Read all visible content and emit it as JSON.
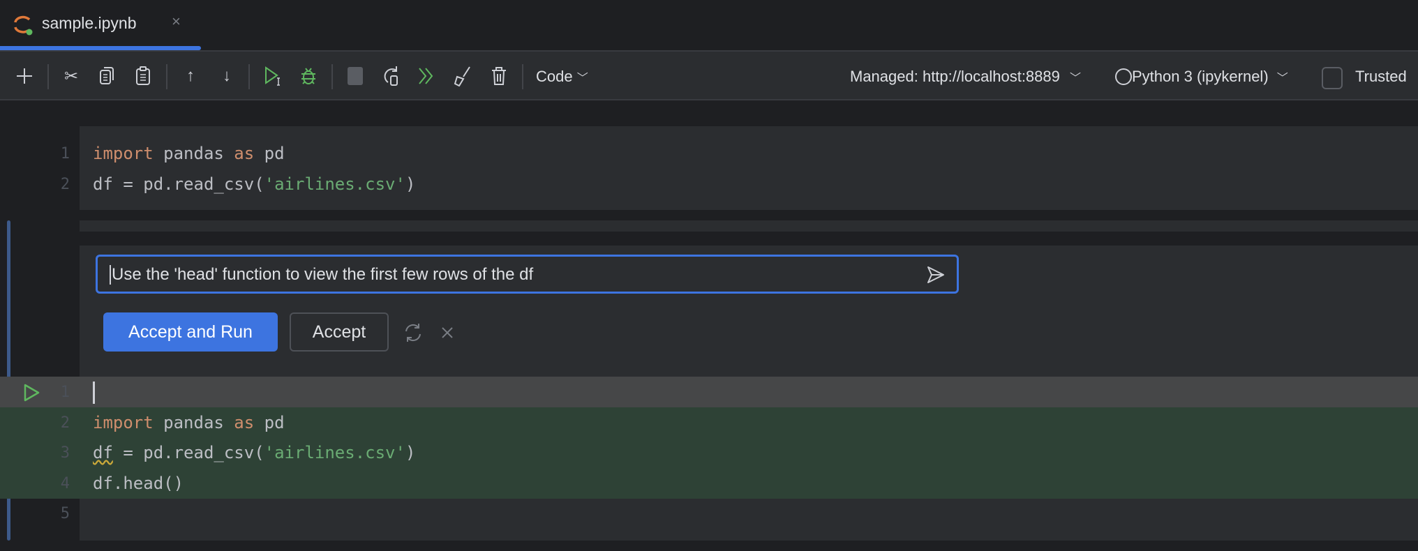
{
  "tab": {
    "title": "sample.ipynb",
    "close": "×"
  },
  "toolbar": {
    "cell_type": "Code",
    "server": "Managed: http://localhost:8889",
    "kernel": "Python 3 (ipykernel)",
    "trusted": "Trusted"
  },
  "cell1": {
    "lines": [
      {
        "num": "1",
        "parts": [
          [
            "import",
            "kw"
          ],
          [
            " pandas ",
            ""
          ],
          [
            "as",
            "kw"
          ],
          [
            " pd",
            ""
          ]
        ]
      },
      {
        "num": "2",
        "parts": [
          [
            "df = pd.read_csv(",
            ""
          ],
          [
            "'airlines.csv'",
            "str"
          ],
          [
            ")",
            ""
          ]
        ]
      }
    ]
  },
  "ai": {
    "prompt": "Use the 'head' function to view the first few rows of the df",
    "accept_run": "Accept and Run",
    "accept": "Accept"
  },
  "cell2": {
    "lines": [
      {
        "num": "1",
        "parts": []
      },
      {
        "num": "2",
        "parts": [
          [
            "import",
            "kw"
          ],
          [
            " pandas ",
            ""
          ],
          [
            "as",
            "kw"
          ],
          [
            " pd",
            ""
          ]
        ]
      },
      {
        "num": "3",
        "parts": [
          [
            "df",
            "warn"
          ],
          [
            " = pd.read_csv(",
            ""
          ],
          [
            "'airlines.csv'",
            "str"
          ],
          [
            ")",
            ""
          ]
        ]
      },
      {
        "num": "4",
        "parts": [
          [
            "df.head()",
            ""
          ]
        ]
      },
      {
        "num": "5",
        "parts": []
      }
    ]
  },
  "colors": {
    "accent": "#3d74e0",
    "keyword": "#cf8e6d",
    "string": "#6aab73",
    "added_bg": "#2e4236"
  }
}
